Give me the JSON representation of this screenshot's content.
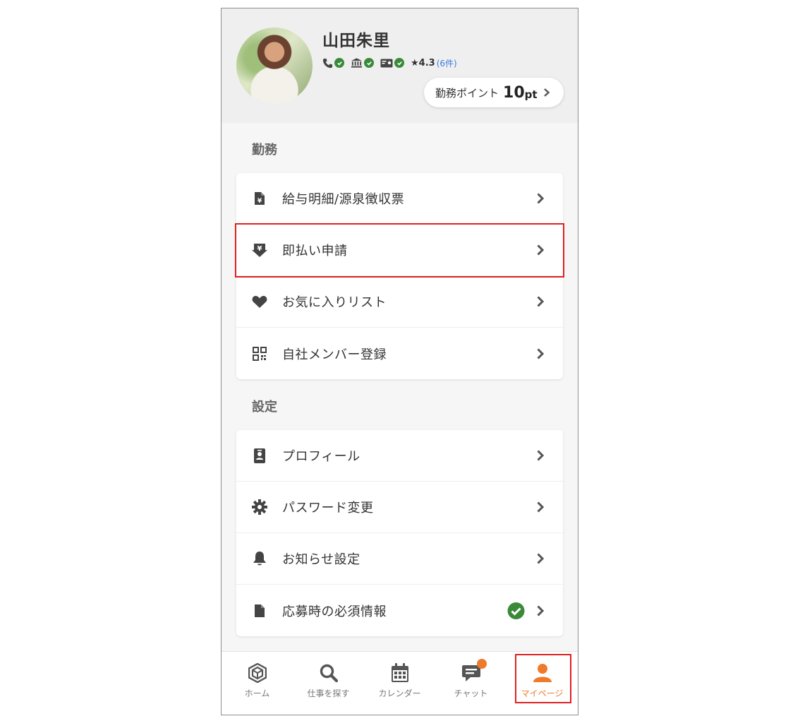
{
  "profile": {
    "name": "山田朱里",
    "rating": "★4.3",
    "review_count": "(6件)",
    "points_label": "勤務ポイント",
    "points_value": "10",
    "points_unit": "pt"
  },
  "sections": [
    {
      "title": "勤務",
      "items": [
        {
          "label": "給与明細/源泉徴収票",
          "icon": "receipt-icon"
        },
        {
          "label": "即払い申請",
          "icon": "yen-download-icon"
        },
        {
          "label": "お気に入りリスト",
          "icon": "heart-icon"
        },
        {
          "label": "自社メンバー登録",
          "icon": "qr-code-icon"
        }
      ]
    },
    {
      "title": "設定",
      "items": [
        {
          "label": "プロフィール",
          "icon": "id-badge-icon"
        },
        {
          "label": "パスワード変更",
          "icon": "gear-icon"
        },
        {
          "label": "お知らせ設定",
          "icon": "bell-icon"
        },
        {
          "label": "応募時の必須情報",
          "icon": "document-icon",
          "status": "complete"
        }
      ]
    }
  ],
  "tabs": [
    {
      "label": "ホーム",
      "icon": "home-hex-icon"
    },
    {
      "label": "仕事を探す",
      "icon": "search-icon"
    },
    {
      "label": "カレンダー",
      "icon": "calendar-icon"
    },
    {
      "label": "チャット",
      "icon": "chat-icon",
      "has_notification": true
    },
    {
      "label": "マイページ",
      "icon": "person-icon",
      "active": true
    }
  ],
  "colors": {
    "accent": "#ef7a2a",
    "verified": "#3a8a3a",
    "link": "#3b7be0",
    "highlight_box": "#e02020"
  }
}
